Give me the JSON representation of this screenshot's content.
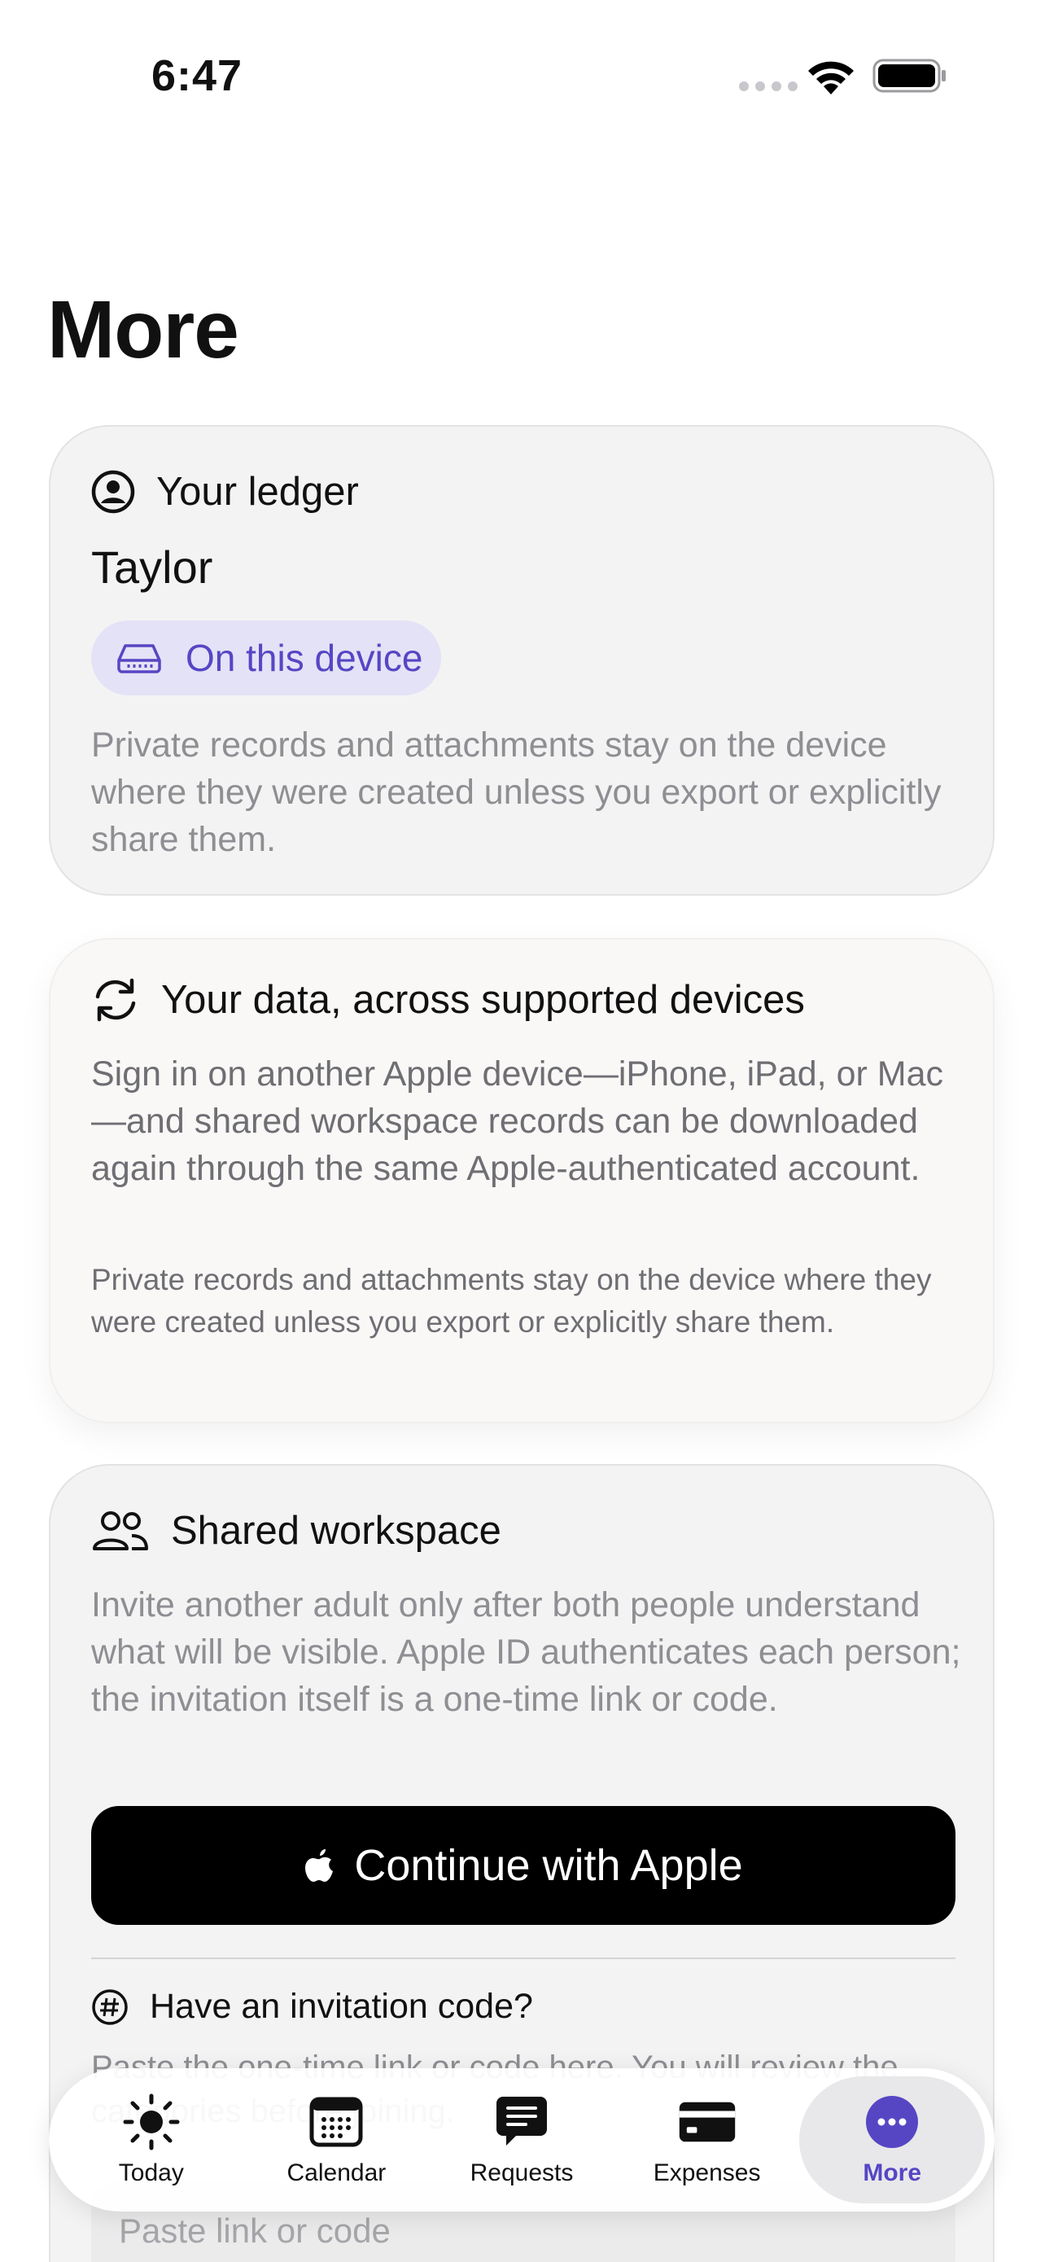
{
  "status_bar": {
    "time": "6:47"
  },
  "page_title": "More",
  "ledger_card": {
    "heading": "Your ledger",
    "name": "Taylor",
    "storage_pill": "On this device",
    "description": "Private records and attachments stay on the device where they were created unless you export or explicitly share them."
  },
  "sync_card": {
    "heading": "Your data, across supported devices",
    "description": "Sign in on another Apple device—iPhone, iPad, or Mac—and shared workspace records can be downloaded again through the same Apple-authenticated account.",
    "note": "Private records and attachments stay on the device where they were created unless you export or explicitly share them."
  },
  "shared_card": {
    "heading": "Shared workspace",
    "description": "Invite another adult only after both people understand what will be visible. Apple ID authenticates each person; the invitation itself is a one-time link or code.",
    "apple_button": "Continue with Apple",
    "invite_heading": "Have an invitation code?",
    "invite_text": "Paste the one-time link or code here. You will review the categories before joining.",
    "paste_placeholder": "Paste link or code"
  },
  "tabbar": {
    "tabs": [
      {
        "label": "Today",
        "icon": "sun-icon"
      },
      {
        "label": "Calendar",
        "icon": "calendar-icon"
      },
      {
        "label": "Requests",
        "icon": "message-icon"
      },
      {
        "label": "Expenses",
        "icon": "card-icon"
      },
      {
        "label": "More",
        "icon": "ellipsis-circle-icon",
        "active": true
      }
    ]
  },
  "colors": {
    "accent": "#5646c4",
    "pill_background": "#e4e2f6",
    "card_background": "#f3f3f3",
    "button_background": "#000000"
  }
}
